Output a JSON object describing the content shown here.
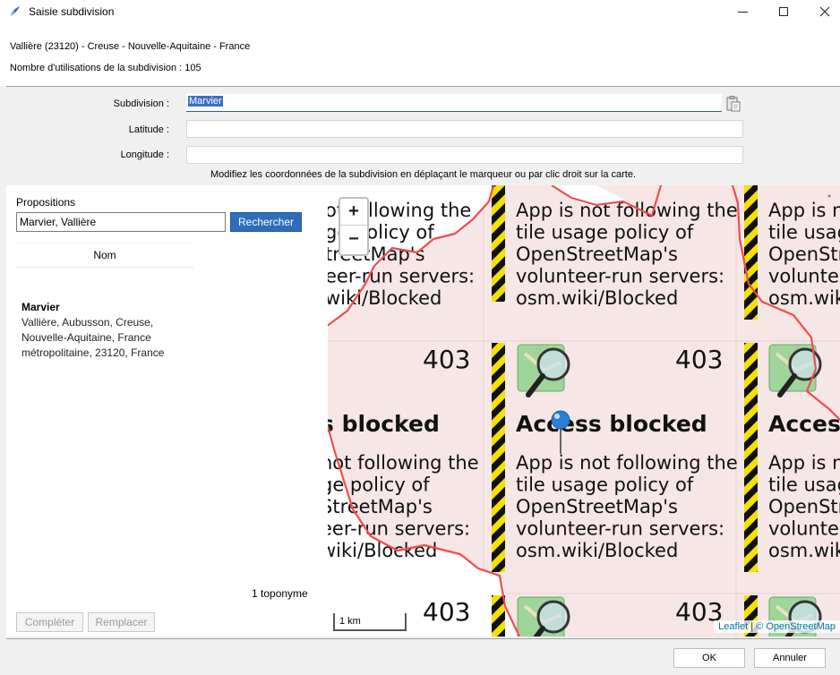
{
  "window": {
    "title": "Saisie subdivision"
  },
  "info": {
    "location": "Vallière (23120) - Creuse - Nouvelle-Aquitaine - France",
    "usage_count": "Nombre d'utilisations de la subdivision : 105"
  },
  "form": {
    "subdivision_label": "Subdivision :",
    "subdivision_value": "Marvier",
    "latitude_label": "Latitude :",
    "latitude_value": "",
    "longitude_label": "Longitude :",
    "longitude_value": "",
    "hint": "Modifiez les coordonnées de la subdivision en déplaçant le marqueur ou par clic droit sur la carte."
  },
  "left": {
    "propositions_label": "Propositions",
    "search_value": "Marvier, Vallière",
    "search_button": "Rechercher",
    "column_header": "Nom",
    "results": [
      {
        "title": "Marvier",
        "address": "Vallière, Aubusson, Creuse, Nouvelle-Aquitaine, France métropolitaine, 23120, France"
      }
    ],
    "count": "1 toponyme",
    "complete_button": "Compléter",
    "replace_button": "Remplacer"
  },
  "map": {
    "zoom_in": "+",
    "zoom_out": "−",
    "scale": "1 km",
    "attribution_leaflet": "Leaflet",
    "attribution_sep": "|",
    "attribution_copy": "© OpenStreetMap",
    "tile_code": "403",
    "tile_heading": "Access blocked",
    "tile_heading_partial": "s blocked",
    "tile_heading_right": "Access",
    "tile_body": [
      "App is not following the",
      "tile usage policy of",
      "OpenStreetMap's",
      "volunteer-run servers:",
      "osm.wiki/Blocked"
    ],
    "tile_body_left": [
      "not following the",
      "ge policy of",
      "StreetMap's",
      "eer-run servers:",
      "wiki/Blocked"
    ],
    "tile_body_left_top": [
      "ot following the",
      "ge policy of",
      "treetMap's",
      "eer-run servers:",
      "wiki/Blocked"
    ],
    "tile_body_right": [
      "App is not",
      "tile usag",
      "OpenStr",
      "volunte",
      "osm.wiki"
    ],
    "tile_bg": "#f7e6e6",
    "border_color": "#ef4d4d",
    "marker_color": "#2a7fd4"
  },
  "bottom": {
    "ok_button": "OK",
    "cancel_button": "Annuler"
  }
}
